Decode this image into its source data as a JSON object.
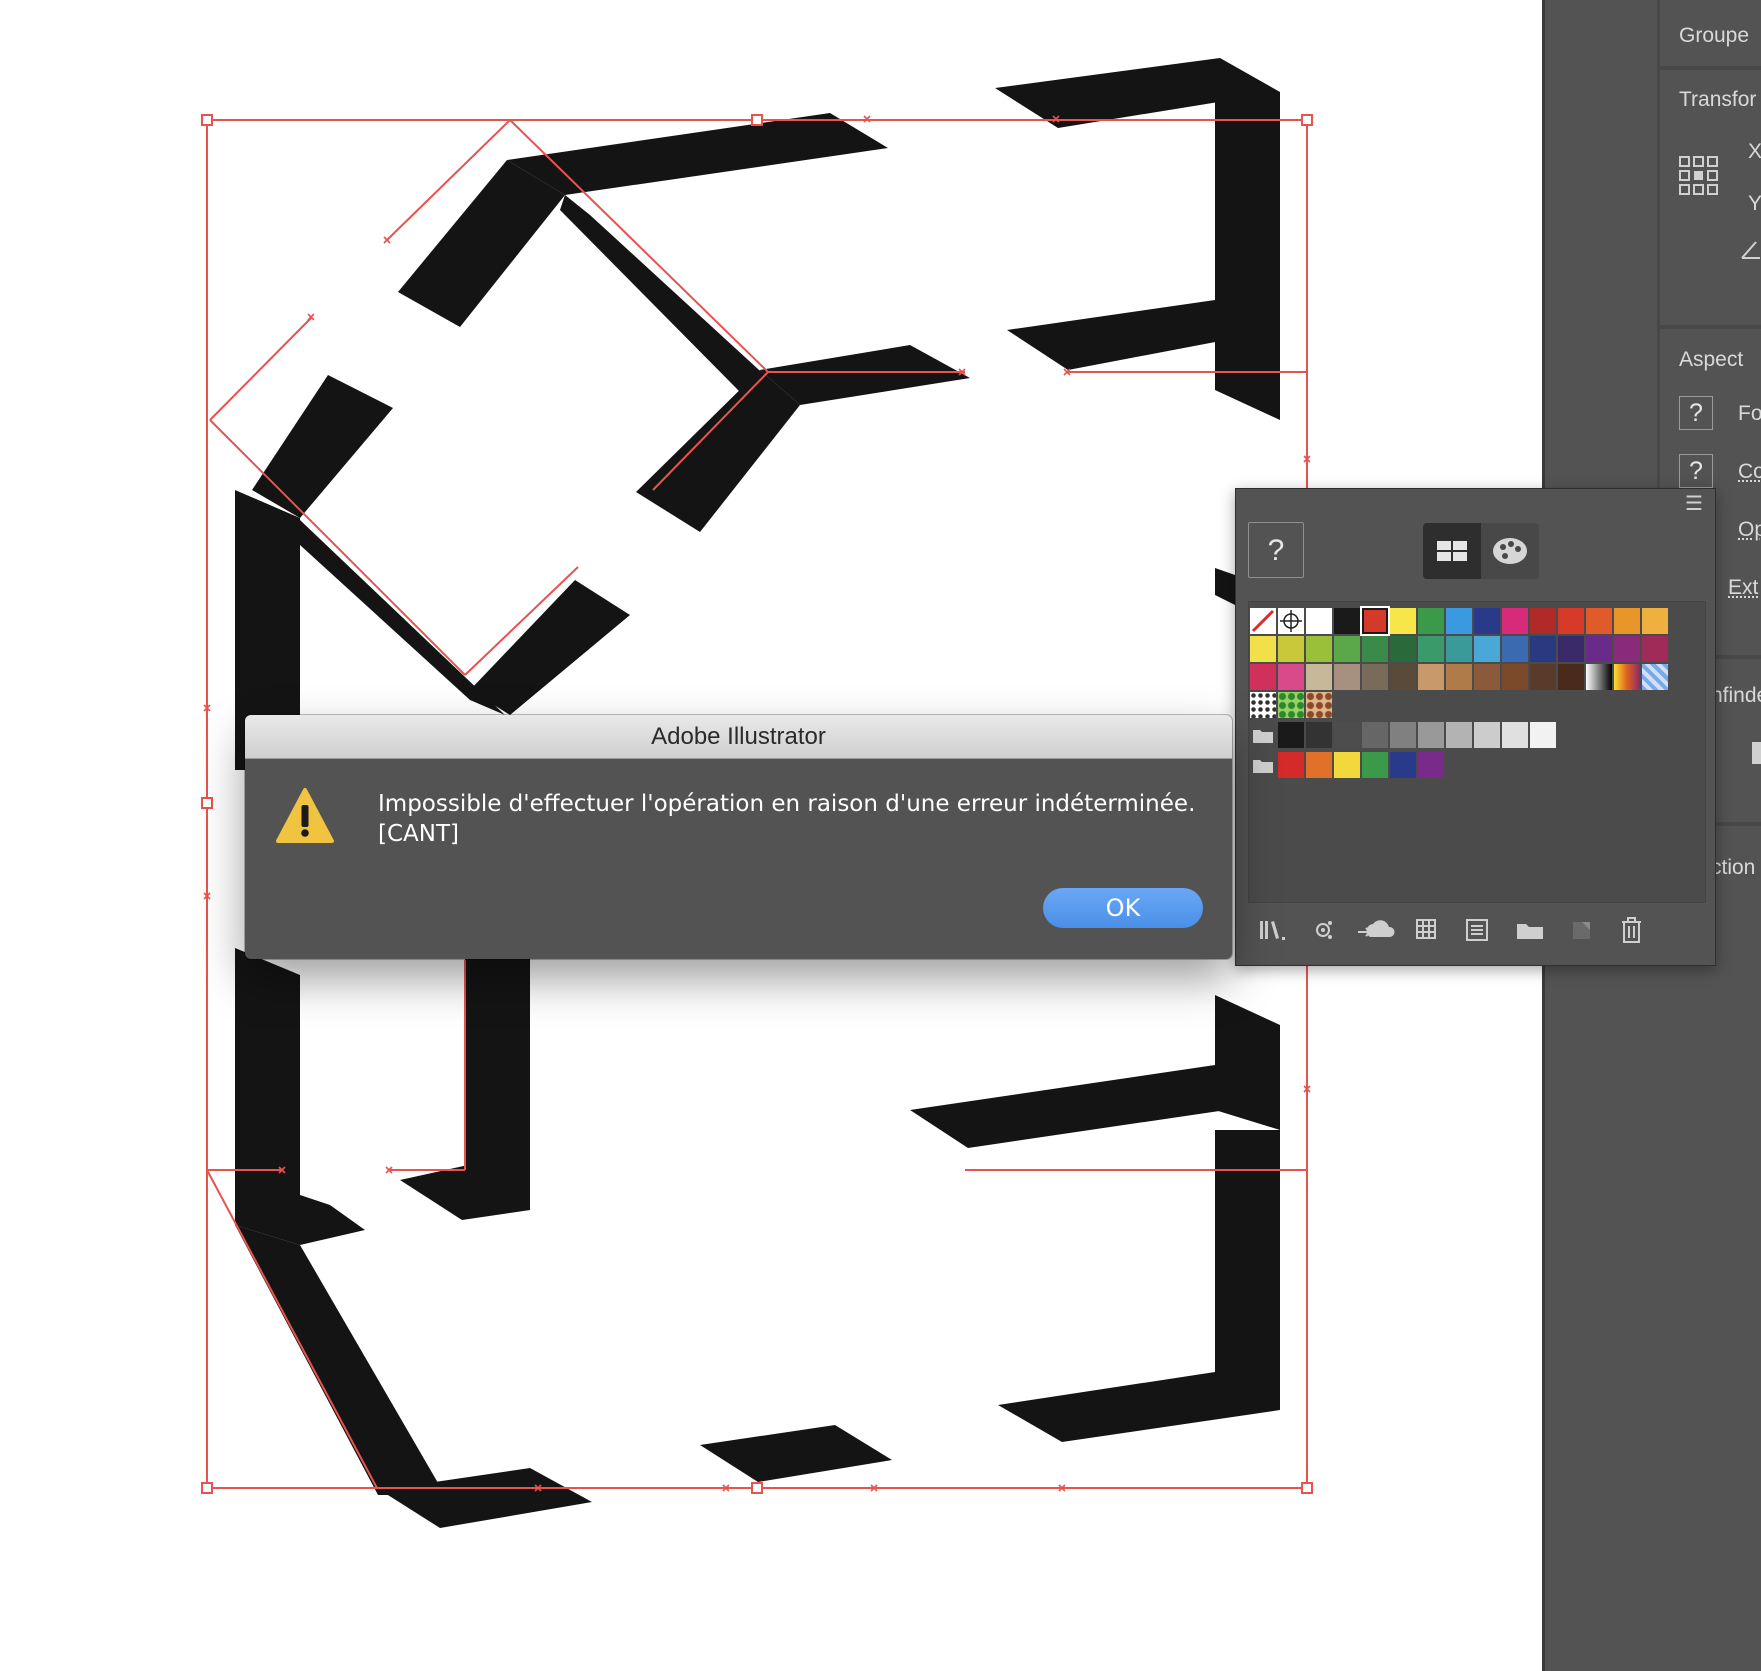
{
  "properties_panel": {
    "object_type": "Groupe",
    "transform_title": "Transfor",
    "x_label": "X",
    "y_label": "Y",
    "aspect_title": "Aspect",
    "fill_label": "Fo",
    "stroke_label": "Co",
    "opacity_label": "Op",
    "effects_label": "Ext",
    "pathfinder_title": "nfinde",
    "selection_title": "ction",
    "unknown_glyph": "?"
  },
  "swatches_panel": {
    "unknown_glyph": "?",
    "rows": [
      [
        "none",
        "registration",
        "#ffffff",
        "#1a1a1a",
        "#d43a2a",
        "#f6e64a",
        "#3a9a4a",
        "#3a9ae0",
        "#2a3a8a",
        "#d82a7a",
        "#b02a2a",
        "#d83a2a",
        "#e05a2a",
        "#e8962a",
        "#f0b040"
      ],
      [
        "#f2e04a",
        "#c8c83a",
        "#9ac03a",
        "#5aa84a",
        "#3a8a4a",
        "#2a6a3a",
        "#3a9a6a",
        "#3a9a9a",
        "#4aa8d8",
        "#3a6ab0",
        "#2a3a80",
        "#3a2a6a",
        "#6a2a8a",
        "#8a2a7a",
        "#a02a5a"
      ],
      [
        "#d0305a",
        "#d84a8a",
        "#c8b89a",
        "#a89080",
        "#7a6a5a",
        "#5a4a3a",
        "#c89a6a",
        "#b07a4a",
        "#8a5a3a",
        "#7a4a2a",
        "#5a3a2a",
        "#4a2a1a",
        "gradient-bw",
        "gradient-orange",
        "pattern-blue"
      ],
      [
        "pattern-dots",
        "pattern-leaves",
        "pattern-paisley"
      ],
      [
        "folder",
        "#1a1a1a",
        "#333333",
        "#4d4d4d",
        "#666666",
        "#808080",
        "#999999",
        "#b3b3b3",
        "#cccccc",
        "#e0e0e0",
        "#f2f2f2"
      ],
      [
        "folder",
        "#d42a2a",
        "#e0702a",
        "#f2d83a",
        "#3a9a4a",
        "#2a3a8a",
        "#7a2a8a"
      ]
    ]
  },
  "dialog": {
    "title": "Adobe Illustrator",
    "message_line1": "Impossible d'effectuer l'opération en raison d'une erreur indéterminée.",
    "message_line2": "[CANT]",
    "ok_label": "OK",
    "warning_color": "#f0c440"
  },
  "colors": {
    "selection": "#e8534f",
    "artwork": "#141414",
    "panel_bg": "#535353",
    "dialog_button": "#5a9bf0"
  }
}
